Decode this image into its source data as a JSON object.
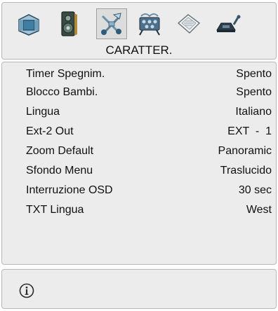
{
  "header": {
    "title": "CARATTER.",
    "icons": [
      {
        "name": "picture-icon"
      },
      {
        "name": "sound-icon"
      },
      {
        "name": "features-icon",
        "active": true
      },
      {
        "name": "install-icon"
      },
      {
        "name": "source-icon"
      },
      {
        "name": "setup-icon"
      }
    ]
  },
  "settings": [
    {
      "label": "Timer Spegnim.",
      "value": "Spento"
    },
    {
      "label": "Blocco Bambi.",
      "value": "Spento"
    },
    {
      "label": "Lingua",
      "value": "Italiano"
    },
    {
      "label": "Ext-2 Out",
      "value": "EXT  -  1"
    },
    {
      "label": "Zoom Default",
      "value": "Panoramic"
    },
    {
      "label": "Sfondo Menu",
      "value": "Traslucido"
    },
    {
      "label": "Interruzione OSD",
      "value": "30 sec"
    },
    {
      "label": "TXT Lingua",
      "value": "West"
    }
  ],
  "info": {
    "icon": "info-icon"
  }
}
